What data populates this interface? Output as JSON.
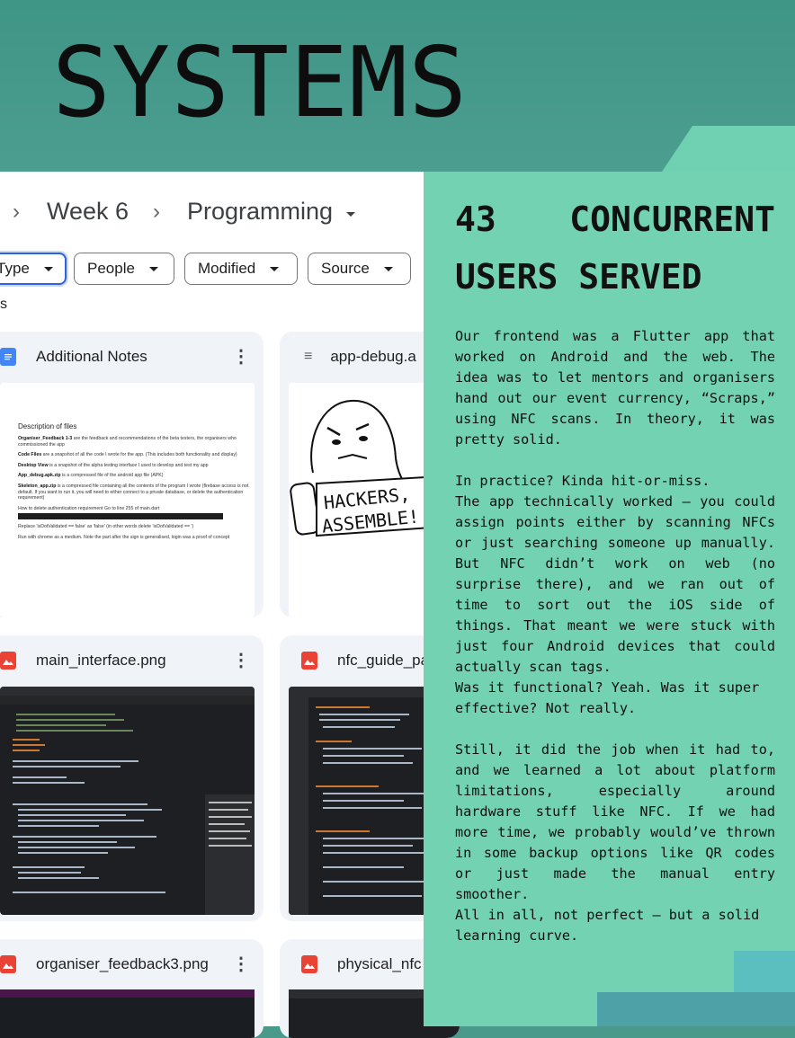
{
  "page": {
    "title": "SYSTEMS",
    "colors": {
      "header_teal": "#4a9a8c",
      "panel_mint": "#72d2b1",
      "drive_blue": "#2f63d6"
    }
  },
  "drive": {
    "breadcrumb": [
      {
        "label": "Week 6"
      },
      {
        "label": "Programming"
      }
    ],
    "filters": [
      {
        "label": "Type"
      },
      {
        "label": "People"
      },
      {
        "label": "Modified"
      },
      {
        "label": "Source"
      }
    ],
    "section_fragment": "s",
    "files": [
      {
        "name": "Additional Notes",
        "icon": "doc-icon"
      },
      {
        "name": "app-debug.a",
        "icon": "zip-icon"
      },
      {
        "name": "main_interface.png",
        "icon": "image-icon"
      },
      {
        "name": "nfc_guide_pa",
        "icon": "image-icon"
      },
      {
        "name": "organiser_feedback3.png",
        "icon": "image-icon"
      },
      {
        "name": "physical_nfc",
        "icon": "image-icon"
      }
    ],
    "doc_preview": {
      "title": "Description of files",
      "lines": [
        {
          "b": "Organiser_Feedback 1-3",
          "t": " are the feedback and recommendations of the beta testers, the organisers who commissioned the app"
        },
        {
          "b": "Code Files",
          "t": " are a snapshot of all the code I wrote for the app. (This includes both functionality and display)"
        },
        {
          "b": "Desktop View",
          "t": " is a snapshot of the alpha testing interface I used to develop and test my app"
        },
        {
          "b": "App_debug.apk.zip",
          "t": " is a compressed file of the android app file (APK)"
        },
        {
          "b": "Skeleton_app.zip",
          "t": " is a compressed file containing all the contents of the program I wrote (firebase access is not default. If you want to run it, you will need to either connect to a private database, or delete the authentication requirement)"
        },
        {
          "b": "",
          "t": "How to delete authentication requirement Go to line 255 of main.dart"
        },
        {
          "b": "",
          "t": "Replace 'isDotValidated == false' as 'false' (in other words delete 'isDotValidated == ')"
        },
        {
          "b": "",
          "t": "Run with chrome as a medium. Note the part after the sign is generalised, login was a proof of concept"
        }
      ]
    }
  },
  "sticker": {
    "text_line1": "HACKERS,",
    "text_line2": "ASSEMBLE!"
  },
  "article": {
    "heading_line1": "43 CONCURRENT",
    "heading_line2": "USERS SERVED",
    "paragraphs": [
      "Our frontend was a Flutter app that worked on Android and the web. The idea was to let mentors and organisers hand out our event currency, “Scraps,” using NFC scans. In theory, it was pretty solid.",
      "",
      "In practice? Kinda hit-or-miss.",
      "The app technically worked — you could assign points either by scanning NFCs or just searching someone up manually. But NFC didn’t work on web (no surprise there), and we ran out of time to sort out the iOS side of things. That meant we were stuck with just four Android devices that could actually scan tags.",
      "Was it functional? Yeah. Was it super effective? Not really.",
      "",
      "Still, it did the job when it had to, and we learned a lot about platform limitations, especially around hardware stuff like NFC. If we had more time, we probably would’ve thrown in some backup options like QR codes or just made the manual entry smoother.",
      "All in all, not perfect — but a solid learning curve."
    ]
  }
}
